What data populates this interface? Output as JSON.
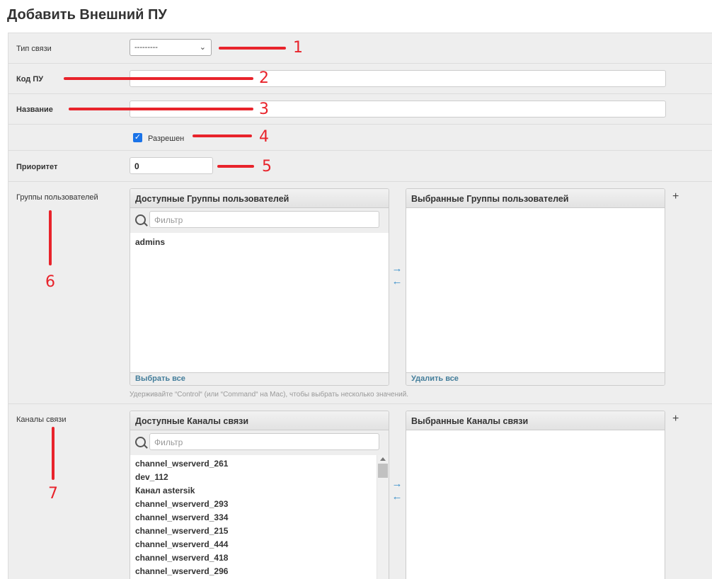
{
  "page": {
    "title": "Добавить Внешний ПУ"
  },
  "fields": {
    "connection_type": {
      "label": "Тип связи",
      "value": "---------"
    },
    "code": {
      "label": "Код ПУ",
      "value": ""
    },
    "name": {
      "label": "Название",
      "value": ""
    },
    "enabled": {
      "label": "Разрешен",
      "checked": true
    },
    "priority": {
      "label": "Приоритет",
      "value": "0"
    }
  },
  "user_groups": {
    "label": "Группы пользователей",
    "available_title": "Доступные Группы пользователей",
    "filter_placeholder": "Фильтр",
    "available_items": [
      "admins"
    ],
    "choose_all": "Выбрать все",
    "selected_title": "Выбранные Группы пользователей",
    "remove_all": "Удалить все",
    "help": "Удерживайте “Control“ (или “Command“ на Mac), чтобы выбрать несколько значений."
  },
  "channels": {
    "label": "Каналы связи",
    "available_title": "Доступные Каналы связи",
    "filter_placeholder": "Фильтр",
    "available_items": [
      "channel_wserverd_261",
      "dev_112",
      "Канал astersik",
      "channel_wserverd_293",
      "channel_wserverd_334",
      "channel_wserverd_215",
      "channel_wserverd_444",
      "channel_wserverd_418",
      "channel_wserverd_296"
    ],
    "selected_title": "Выбранные Каналы связи"
  },
  "controls": {
    "move_right": "→",
    "move_left": "←",
    "add": "+"
  },
  "annotations": [
    "1",
    "2",
    "3",
    "4",
    "5",
    "6",
    "7"
  ],
  "colors": {
    "annotation": "#e8232b",
    "link": "#447e9b",
    "arrows": "#3a8fc9",
    "checkbox": "#1a73e8"
  }
}
